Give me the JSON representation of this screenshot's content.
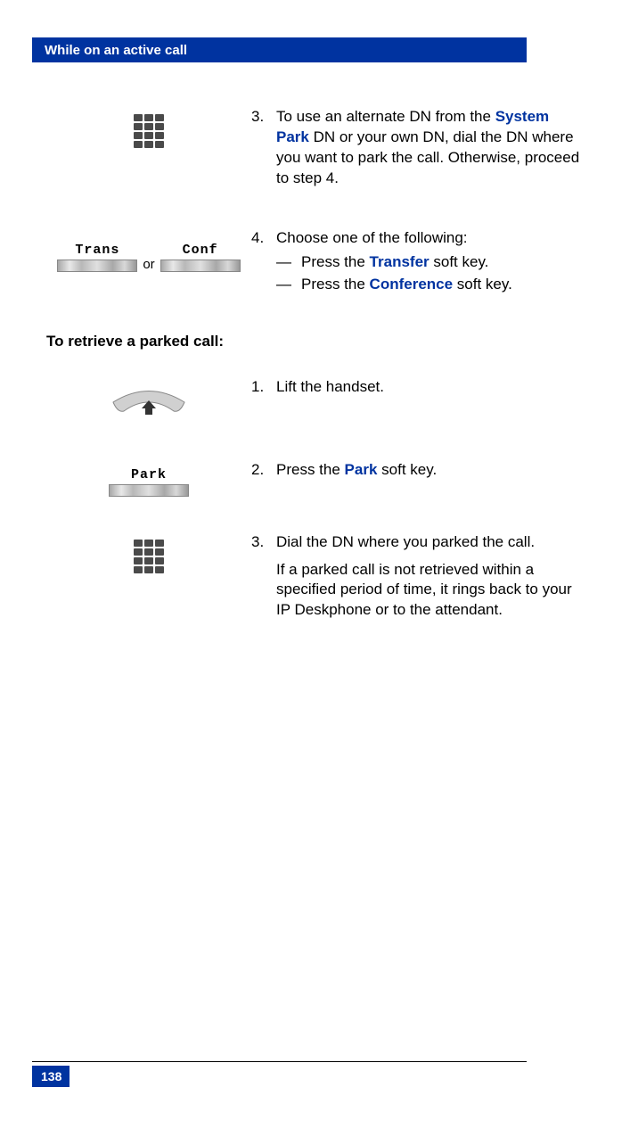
{
  "header": {
    "title": "While on an active call"
  },
  "steps_a": {
    "s3": {
      "num": "3.",
      "pre": "To use an alternate DN from the ",
      "link": "System Park",
      "post": " DN or your own DN, dial the DN where you want to park the call. Otherwise, proceed to step 4."
    },
    "s4": {
      "num": "4.",
      "text": "Choose one of the following:",
      "sub_a": {
        "dash": "—",
        "pre": "Press the ",
        "link": "Transfer",
        "post": " soft key."
      },
      "sub_b": {
        "dash": "—",
        "pre": "Press the ",
        "link": "Conference",
        "post": " soft key."
      }
    }
  },
  "softkeys": {
    "trans": "Trans",
    "conf": "Conf",
    "or": "or",
    "park": "Park"
  },
  "section_title": "To retrieve a parked call:",
  "steps_b": {
    "s1": {
      "num": "1.",
      "text": "Lift the handset."
    },
    "s2": {
      "num": "2.",
      "pre": "Press the ",
      "link": "Park",
      "post": " soft key."
    },
    "s3": {
      "num": "3.",
      "text": "Dial the DN where you parked the call.",
      "extra": "If a parked call is not retrieved within a specified period of time, it rings back to your IP Deskphone or to the attendant."
    }
  },
  "page_number": "138"
}
